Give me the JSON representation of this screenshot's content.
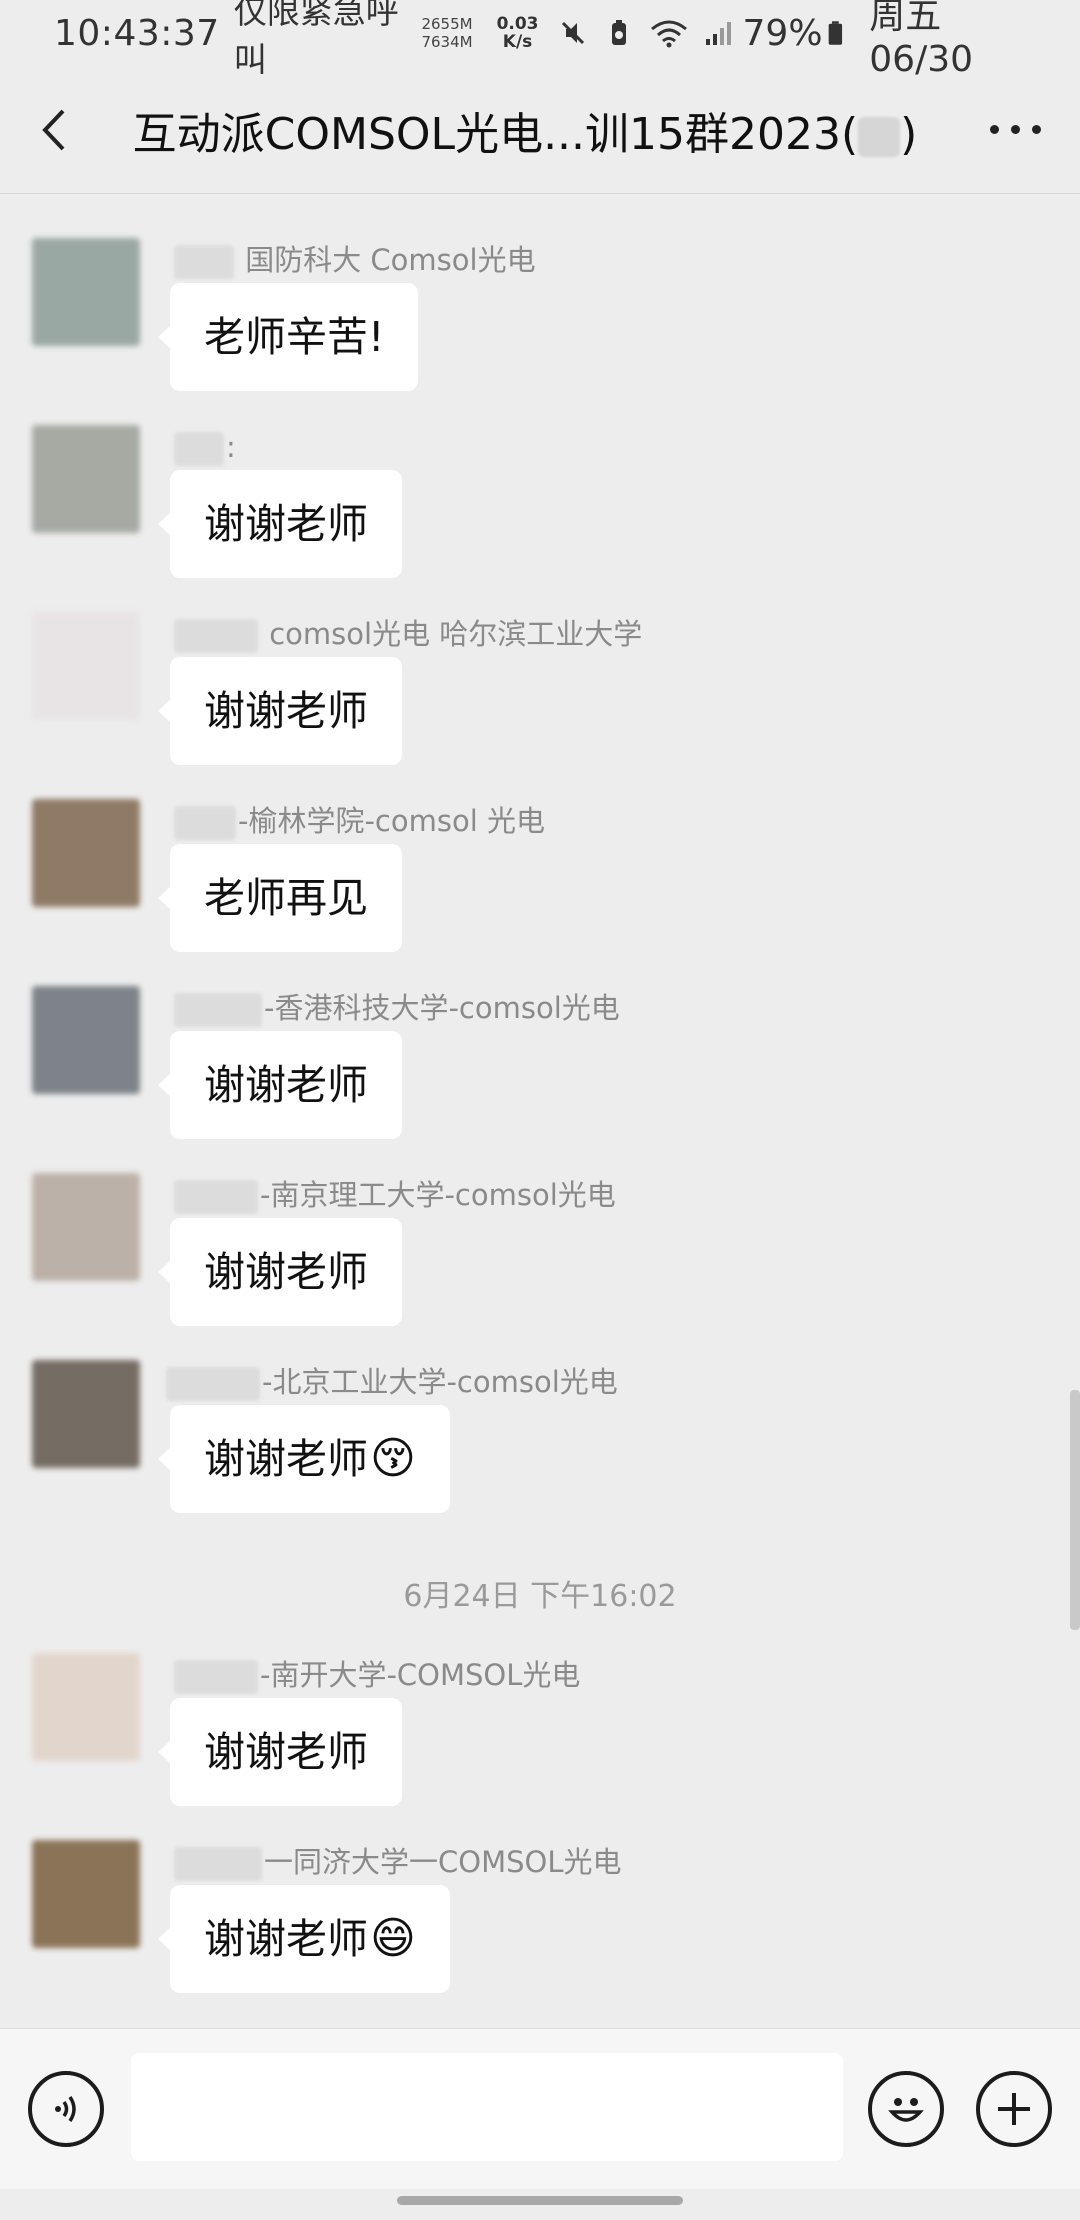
{
  "status_bar": {
    "time": "10:43:37",
    "carrier": "仅限紧急呼叫",
    "mem_used": "2655M",
    "mem_total": "7634M",
    "speed_value": "0.03",
    "speed_unit": "K/s",
    "battery": "79%",
    "date": "周五 06/30"
  },
  "header": {
    "title_prefix": "互动派COMSOL光电...训15群2023(",
    "title_suffix": ")"
  },
  "messages": [
    {
      "sender": "国防科大 Comsol光电",
      "text": "老师辛苦!",
      "avatar_color": "#9aa8a3"
    },
    {
      "sender": ":",
      "text": "谢谢老师",
      "avatar_color": "#a6aaa3"
    },
    {
      "sender": "comsol光电 哈尔滨工业大学",
      "text": "谢谢老师",
      "avatar_color": "#e8e4e6"
    },
    {
      "sender": "-榆林学院-comsol 光电",
      "text": "老师再见",
      "avatar_color": "#8f7a66"
    },
    {
      "sender": "-香港科技大学-comsol光电",
      "text": "谢谢老师",
      "avatar_color": "#7d8388"
    },
    {
      "sender": "-南京理工大学-comsol光电",
      "text": "谢谢老师",
      "avatar_color": "#bcb1a8"
    },
    {
      "sender": "-北京工业大学-comsol光电",
      "text": "谢谢老师",
      "emoji": "😚",
      "avatar_color": "#756d63"
    },
    {
      "sender": "-南开大学-COMSOL光电",
      "text": "谢谢老师",
      "avatar_color": "#e2d6cc"
    },
    {
      "sender": "一同济大学一COMSOL光电",
      "text": "谢谢老师",
      "emoji": "😄",
      "avatar_color": "#8a7457"
    }
  ],
  "timestamp": "6月24日 下午16:02",
  "input": {
    "voice_icon": "voice-icon",
    "emoji_icon": "emoji-icon",
    "plus_icon": "plus-icon",
    "placeholder": ""
  }
}
